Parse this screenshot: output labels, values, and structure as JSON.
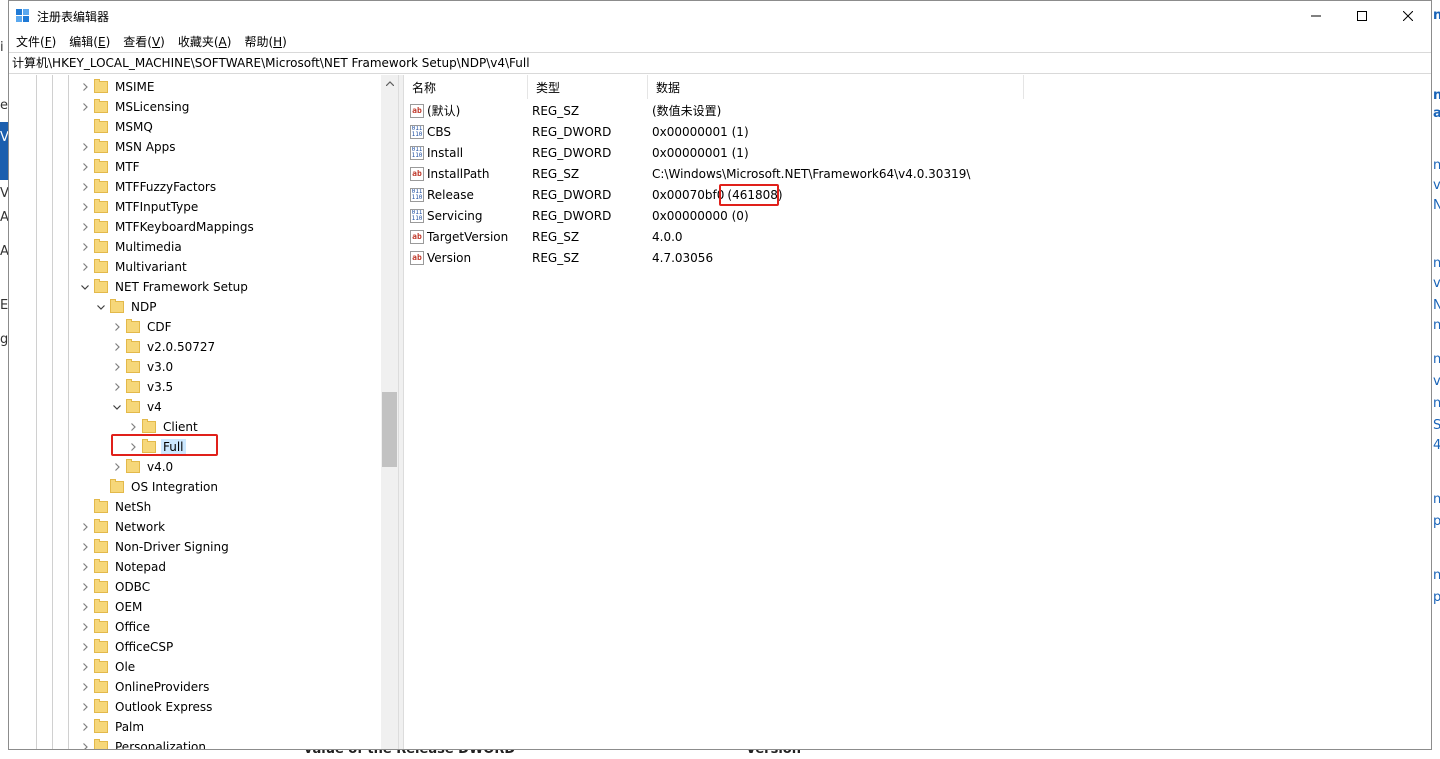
{
  "window": {
    "title": "注册表编辑器",
    "controls": [
      "minimize-icon",
      "maximize-icon",
      "close-icon"
    ]
  },
  "menu": [
    {
      "label": "文件(",
      "key": "F",
      "end": ")"
    },
    {
      "label": "编辑(",
      "key": "E",
      "end": ")"
    },
    {
      "label": "查看(",
      "key": "V",
      "end": ")"
    },
    {
      "label": "收藏夹(",
      "key": "A",
      "end": ")"
    },
    {
      "label": "帮助(",
      "key": "H",
      "end": ")"
    }
  ],
  "address": "计算机\\HKEY_LOCAL_MACHINE\\SOFTWARE\\Microsoft\\NET Framework Setup\\NDP\\v4\\Full",
  "tree": [
    {
      "label": "MSIME",
      "level": 0,
      "expander": "collapsed"
    },
    {
      "label": "MSLicensing",
      "level": 0,
      "expander": "collapsed"
    },
    {
      "label": "MSMQ",
      "level": 0,
      "expander": "none"
    },
    {
      "label": "MSN Apps",
      "level": 0,
      "expander": "collapsed"
    },
    {
      "label": "MTF",
      "level": 0,
      "expander": "collapsed"
    },
    {
      "label": "MTFFuzzyFactors",
      "level": 0,
      "expander": "collapsed"
    },
    {
      "label": "MTFInputType",
      "level": 0,
      "expander": "collapsed"
    },
    {
      "label": "MTFKeyboardMappings",
      "level": 0,
      "expander": "collapsed"
    },
    {
      "label": "Multimedia",
      "level": 0,
      "expander": "collapsed"
    },
    {
      "label": "Multivariant",
      "level": 0,
      "expander": "collapsed"
    },
    {
      "label": "NET Framework Setup",
      "level": 0,
      "expander": "expanded"
    },
    {
      "label": "NDP",
      "level": 1,
      "expander": "expanded"
    },
    {
      "label": "CDF",
      "level": 2,
      "expander": "collapsed"
    },
    {
      "label": "v2.0.50727",
      "level": 2,
      "expander": "collapsed"
    },
    {
      "label": "v3.0",
      "level": 2,
      "expander": "collapsed"
    },
    {
      "label": "v3.5",
      "level": 2,
      "expander": "collapsed"
    },
    {
      "label": "v4",
      "level": 2,
      "expander": "expanded"
    },
    {
      "label": "Client",
      "level": 3,
      "expander": "collapsed"
    },
    {
      "label": "Full",
      "level": 3,
      "expander": "collapsed",
      "selected": true
    },
    {
      "label": "v4.0",
      "level": 2,
      "expander": "collapsed"
    },
    {
      "label": "OS Integration",
      "level": 1,
      "expander": "none"
    },
    {
      "label": "NetSh",
      "level": 0,
      "expander": "none"
    },
    {
      "label": "Network",
      "level": 0,
      "expander": "collapsed"
    },
    {
      "label": "Non-Driver Signing",
      "level": 0,
      "expander": "collapsed"
    },
    {
      "label": "Notepad",
      "level": 0,
      "expander": "collapsed"
    },
    {
      "label": "ODBC",
      "level": 0,
      "expander": "collapsed"
    },
    {
      "label": "OEM",
      "level": 0,
      "expander": "collapsed"
    },
    {
      "label": "Office",
      "level": 0,
      "expander": "collapsed"
    },
    {
      "label": "OfficeCSP",
      "level": 0,
      "expander": "collapsed"
    },
    {
      "label": "Ole",
      "level": 0,
      "expander": "collapsed"
    },
    {
      "label": "OnlineProviders",
      "level": 0,
      "expander": "collapsed"
    },
    {
      "label": "Outlook Express",
      "level": 0,
      "expander": "collapsed"
    },
    {
      "label": "Palm",
      "level": 0,
      "expander": "collapsed"
    },
    {
      "label": "Personalization",
      "level": 0,
      "expander": "collapsed"
    }
  ],
  "columns": {
    "name": "名称",
    "type": "类型",
    "data": "数据"
  },
  "values": [
    {
      "name": "(默认)",
      "type": "REG_SZ",
      "data": "(数值未设置)",
      "icon": "string-value-icon"
    },
    {
      "name": "CBS",
      "type": "REG_DWORD",
      "data": "0x00000001 (1)",
      "icon": "binary-value-icon"
    },
    {
      "name": "Install",
      "type": "REG_DWORD",
      "data": "0x00000001 (1)",
      "icon": "binary-value-icon"
    },
    {
      "name": "InstallPath",
      "type": "REG_SZ",
      "data": "C:\\Windows\\Microsoft.NET\\Framework64\\v4.0.30319\\",
      "icon": "string-value-icon"
    },
    {
      "name": "Release",
      "type": "REG_DWORD",
      "data": "0x00070bf0",
      "data_extra": "(461808)",
      "icon": "binary-value-icon"
    },
    {
      "name": "Servicing",
      "type": "REG_DWORD",
      "data": "0x00000000 (0)",
      "icon": "binary-value-icon"
    },
    {
      "name": "TargetVersion",
      "type": "REG_SZ",
      "data": "4.0.0",
      "icon": "string-value-icon"
    },
    {
      "name": "Version",
      "type": "REG_SZ",
      "data": "4.7.03056",
      "icon": "string-value-icon"
    }
  ],
  "background_fragments": {
    "left": [
      "i",
      "e",
      "V",
      "V",
      "A",
      "A",
      "E",
      "g"
    ],
    "right": [
      "n",
      "n",
      "a",
      "n",
      "vi",
      "N",
      "n",
      "vi",
      "N",
      "n",
      "n",
      "vi",
      "n",
      "S",
      "4",
      "n",
      "py",
      "n",
      "py"
    ],
    "bottom": [
      "value of the Release DWORD",
      "Version"
    ]
  }
}
